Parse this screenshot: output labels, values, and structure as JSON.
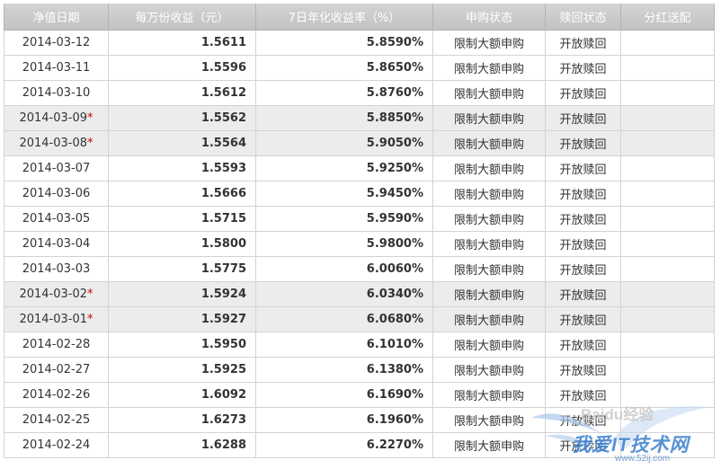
{
  "headers": [
    "净值日期",
    "每万份收益（元）",
    "7日年化收益率（%）",
    "申购状态",
    "赎回状态",
    "分红送配"
  ],
  "rows": [
    {
      "date": "2014-03-12",
      "mark": "",
      "nav": "1.5611",
      "rate": "5.8590%",
      "buy": "限制大额申购",
      "redeem": "开放赎回",
      "dividend": ""
    },
    {
      "date": "2014-03-11",
      "mark": "",
      "nav": "1.5596",
      "rate": "5.8650%",
      "buy": "限制大额申购",
      "redeem": "开放赎回",
      "dividend": ""
    },
    {
      "date": "2014-03-10",
      "mark": "",
      "nav": "1.5612",
      "rate": "5.8760%",
      "buy": "限制大额申购",
      "redeem": "开放赎回",
      "dividend": ""
    },
    {
      "date": "2014-03-09",
      "mark": "*",
      "nav": "1.5562",
      "rate": "5.8850%",
      "buy": "限制大额申购",
      "redeem": "开放赎回",
      "dividend": ""
    },
    {
      "date": "2014-03-08",
      "mark": "*",
      "nav": "1.5564",
      "rate": "5.9050%",
      "buy": "限制大额申购",
      "redeem": "开放赎回",
      "dividend": ""
    },
    {
      "date": "2014-03-07",
      "mark": "",
      "nav": "1.5593",
      "rate": "5.9250%",
      "buy": "限制大额申购",
      "redeem": "开放赎回",
      "dividend": ""
    },
    {
      "date": "2014-03-06",
      "mark": "",
      "nav": "1.5666",
      "rate": "5.9450%",
      "buy": "限制大额申购",
      "redeem": "开放赎回",
      "dividend": ""
    },
    {
      "date": "2014-03-05",
      "mark": "",
      "nav": "1.5715",
      "rate": "5.9590%",
      "buy": "限制大额申购",
      "redeem": "开放赎回",
      "dividend": ""
    },
    {
      "date": "2014-03-04",
      "mark": "",
      "nav": "1.5800",
      "rate": "5.9800%",
      "buy": "限制大额申购",
      "redeem": "开放赎回",
      "dividend": ""
    },
    {
      "date": "2014-03-03",
      "mark": "",
      "nav": "1.5775",
      "rate": "6.0060%",
      "buy": "限制大额申购",
      "redeem": "开放赎回",
      "dividend": ""
    },
    {
      "date": "2014-03-02",
      "mark": "*",
      "nav": "1.5924",
      "rate": "6.0340%",
      "buy": "限制大额申购",
      "redeem": "开放赎回",
      "dividend": ""
    },
    {
      "date": "2014-03-01",
      "mark": "*",
      "nav": "1.5927",
      "rate": "6.0680%",
      "buy": "限制大额申购",
      "redeem": "开放赎回",
      "dividend": ""
    },
    {
      "date": "2014-02-28",
      "mark": "",
      "nav": "1.5950",
      "rate": "6.1010%",
      "buy": "限制大额申购",
      "redeem": "开放赎回",
      "dividend": ""
    },
    {
      "date": "2014-02-27",
      "mark": "",
      "nav": "1.5925",
      "rate": "6.1380%",
      "buy": "限制大额申购",
      "redeem": "开放赎回",
      "dividend": ""
    },
    {
      "date": "2014-02-26",
      "mark": "",
      "nav": "1.6092",
      "rate": "6.1690%",
      "buy": "限制大额申购",
      "redeem": "开放赎回",
      "dividend": ""
    },
    {
      "date": "2014-02-25",
      "mark": "",
      "nav": "1.6273",
      "rate": "6.1960%",
      "buy": "限制大额申购",
      "redeem": "开放赎回",
      "dividend": ""
    },
    {
      "date": "2014-02-24",
      "mark": "",
      "nav": "1.6288",
      "rate": "6.2270%",
      "buy": "限制大额申购",
      "redeem": "开放赎回",
      "dividend": ""
    }
  ],
  "watermark": {
    "brand": "Baidu经验",
    "site_cn": "我爱IT技术网",
    "url": "www.52ij.com"
  },
  "colors": {
    "header_bg": "#c8c8c8",
    "weekend_row_bg": "#ececec",
    "asterisk": "#cc0000",
    "watermark": "#3a7fd0"
  }
}
